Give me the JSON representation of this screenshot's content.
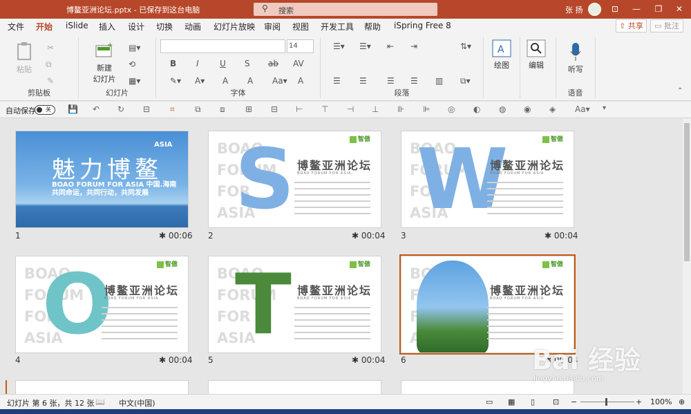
{
  "titlebar": {
    "title": "博鳌亚洲论坛.pptx - 已保存到这台电脑",
    "search_placeholder": "搜索",
    "user": "张 扬",
    "min": "—",
    "restore": "❐",
    "close": "✕",
    "ribbon_toggle": "⊡"
  },
  "menu": {
    "tabs": [
      "文件",
      "开始",
      "iSlide",
      "插入",
      "设计",
      "切换",
      "动画",
      "幻灯片放映",
      "审阅",
      "视图",
      "开发工具",
      "帮助",
      "iSpring Free 8"
    ],
    "active": "开始",
    "share": "共享",
    "comment": "批注"
  },
  "ribbon": {
    "clipboard": {
      "paste": "粘贴",
      "label": "剪贴板"
    },
    "slides": {
      "new_slide_1": "新建",
      "new_slide_2": "幻灯片",
      "label": "幻灯片"
    },
    "font": {
      "size": "14",
      "label": "字体"
    },
    "paragraph": {
      "label": "段落"
    },
    "drawing": {
      "label": "绘图"
    },
    "editing": {
      "label": "编辑"
    },
    "voice": {
      "dictate": "听写",
      "label": "语音"
    }
  },
  "qat": {
    "autosave": "自动保存",
    "toggle_state": "关"
  },
  "slides": [
    {
      "num": "1",
      "time": "00:06"
    },
    {
      "num": "2",
      "time": "00:04"
    },
    {
      "num": "3",
      "time": "00:04"
    },
    {
      "num": "4",
      "time": "00:04"
    },
    {
      "num": "5",
      "time": "00:04"
    },
    {
      "num": "6",
      "time": "00:04"
    }
  ],
  "cover": {
    "title": "魅力博鳌",
    "subtitle": "BOAO FORUM FOR ASIA 中国.海南",
    "slogan": "共同命运，共同行动，共同发展",
    "logo": "ASIA"
  },
  "content_slide": {
    "bg_text": [
      "BOAO",
      "FORUM",
      "FOR",
      "ASIA"
    ],
    "title": "博鳌亚洲论坛",
    "en": "BOAO FORUM FOR ASIA",
    "brand": "智傲",
    "letters": [
      "S",
      "W",
      "O",
      "T"
    ]
  },
  "status": {
    "slide_info": "幻灯片 第 6 张，共 12 张",
    "language": "中文(中国)",
    "zoom": "100%"
  },
  "watermark": {
    "main": "Bai 经验",
    "sub": "jingyan.baidu.com"
  }
}
